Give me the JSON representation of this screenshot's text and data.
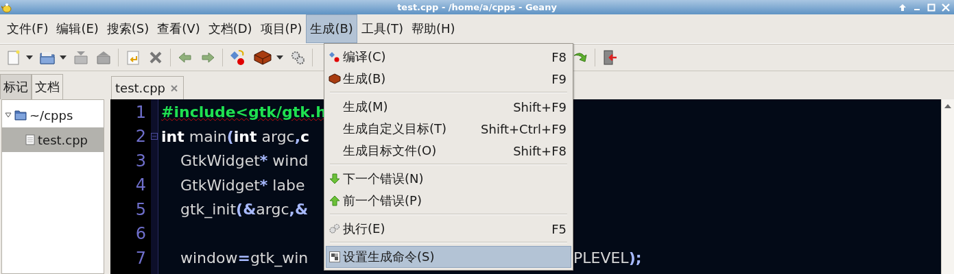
{
  "window": {
    "title": "test.cpp - /home/a/cpps - Geany"
  },
  "menubar": [
    {
      "label": "文件(F)",
      "selected": false
    },
    {
      "label": "编辑(E)",
      "selected": false
    },
    {
      "label": "搜索(S)",
      "selected": false
    },
    {
      "label": "查看(V)",
      "selected": false
    },
    {
      "label": "文档(D)",
      "selected": false
    },
    {
      "label": "项目(P)",
      "selected": false
    },
    {
      "label": "生成(B)",
      "selected": true
    },
    {
      "label": "工具(T)",
      "selected": false
    },
    {
      "label": "帮助(H)",
      "selected": false
    }
  ],
  "sidebar": {
    "tabs": [
      {
        "label": "标记",
        "selected": false
      },
      {
        "label": "文档",
        "selected": true
      }
    ],
    "tree": [
      {
        "label": "~/cpps",
        "expanded": true,
        "selected": false,
        "children": [
          {
            "label": "test.cpp",
            "selected": true
          }
        ]
      }
    ]
  },
  "editor": {
    "tabs": [
      {
        "label": "test.cpp",
        "selected": true
      }
    ],
    "lines": [
      {
        "number": "1",
        "left": [
          {
            "kind": "preproc",
            "text": "#include<gtk/gtk.h"
          }
        ]
      },
      {
        "number": "2",
        "left": [
          {
            "kind": "keyword",
            "text": "int"
          },
          {
            "kind": "plain",
            "text": " main"
          },
          {
            "kind": "punct",
            "text": "("
          },
          {
            "kind": "keyword",
            "text": "int"
          },
          {
            "kind": "plain",
            "text": " argc"
          },
          {
            "kind": "punct",
            "text": ","
          },
          {
            "kind": "keyword",
            "text": "c"
          }
        ]
      },
      {
        "number": "3",
        "left": [
          {
            "kind": "plain",
            "text": "    GtkWidget"
          },
          {
            "kind": "punct",
            "text": "*"
          },
          {
            "kind": "plain",
            "text": " wind"
          }
        ]
      },
      {
        "number": "4",
        "left": [
          {
            "kind": "plain",
            "text": "    GtkWidget"
          },
          {
            "kind": "punct",
            "text": "*"
          },
          {
            "kind": "plain",
            "text": " labe"
          }
        ]
      },
      {
        "number": "5",
        "left": [
          {
            "kind": "plain",
            "text": "    gtk_init"
          },
          {
            "kind": "punct",
            "text": "(&"
          },
          {
            "kind": "plain",
            "text": "argc"
          },
          {
            "kind": "punct",
            "text": ",&"
          }
        ]
      },
      {
        "number": "6"
      },
      {
        "number": "7",
        "left": [
          {
            "kind": "plain",
            "text": "    window"
          },
          {
            "kind": "punct",
            "text": "="
          },
          {
            "kind": "plain",
            "text": "gtk_win"
          }
        ],
        "right": [
          {
            "kind": "plain",
            "text": "PLEVEL"
          },
          {
            "kind": "punct",
            "text": ");"
          }
        ]
      }
    ]
  },
  "build_menu": {
    "items": [
      {
        "kind": "item",
        "label": "编译(C)",
        "shortcut": "F8",
        "selected": false
      },
      {
        "kind": "item",
        "label": "生成(B)",
        "shortcut": "F9",
        "selected": false
      },
      {
        "kind": "separator"
      },
      {
        "kind": "item",
        "label": "生成(M)",
        "shortcut": "Shift+F9",
        "selected": false
      },
      {
        "kind": "item",
        "label": "生成自定义目标(T)",
        "shortcut": "Shift+Ctrl+F9",
        "selected": false
      },
      {
        "kind": "item",
        "label": "生成目标文件(O)",
        "shortcut": "Shift+F8",
        "selected": false
      },
      {
        "kind": "separator"
      },
      {
        "kind": "item",
        "label": "下一个错误(N)",
        "selected": false
      },
      {
        "kind": "item",
        "label": "前一个错误(P)",
        "selected": false
      },
      {
        "kind": "separator"
      },
      {
        "kind": "item",
        "label": "执行(E)",
        "shortcut": "F5",
        "selected": false
      },
      {
        "kind": "separator"
      },
      {
        "kind": "item",
        "label": "设置生成命令(S)",
        "selected": true
      }
    ]
  }
}
